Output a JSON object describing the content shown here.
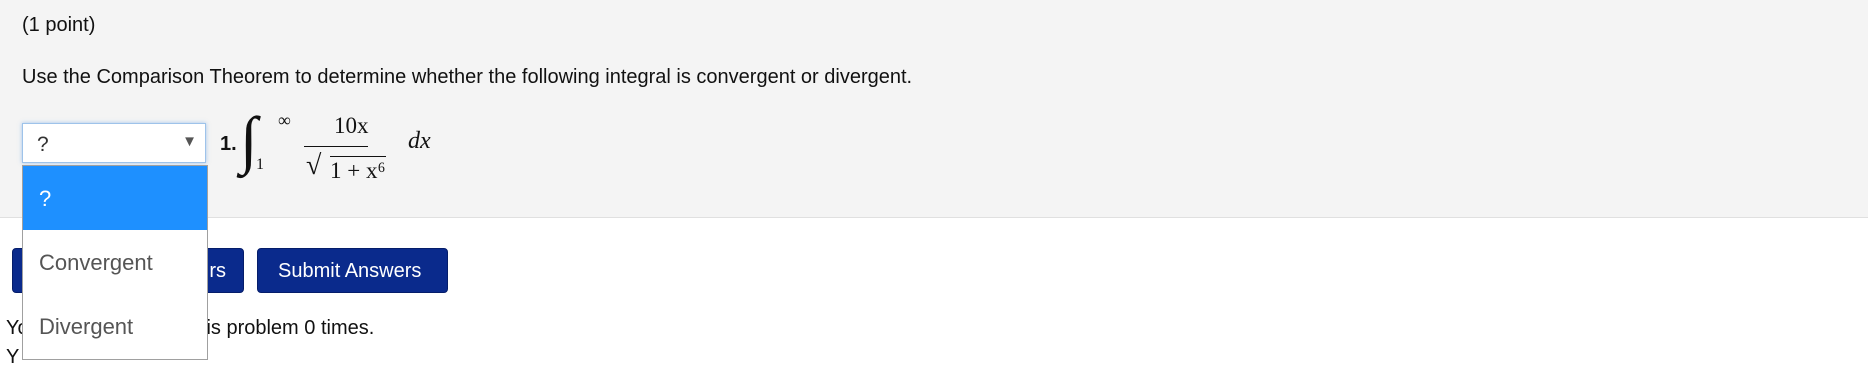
{
  "problem": {
    "points": "(1 point)",
    "instructions": "Use the Comparison Theorem to determine whether the following integral is convergent or divergent."
  },
  "question": {
    "number": "1.",
    "selected_value": "?",
    "options": [
      "?",
      "Convergent",
      "Divergent"
    ],
    "integral": {
      "symbol": "∫",
      "upper_limit": "∞",
      "lower_limit": "1",
      "numerator": "10x",
      "radical_symbol": "√",
      "radicand": "1 + x⁶",
      "differential": "dx"
    }
  },
  "buttons": {
    "preview_label": "rs",
    "submit_label": "Submit Answers"
  },
  "footer": {
    "attempts_text": "Yo                              his problem 0 times.",
    "cutoff_text": "Y"
  },
  "colors": {
    "button_bg": "#0a2a8c",
    "option_highlight": "#1e90ff",
    "panel_bg": "#f4f4f4"
  }
}
